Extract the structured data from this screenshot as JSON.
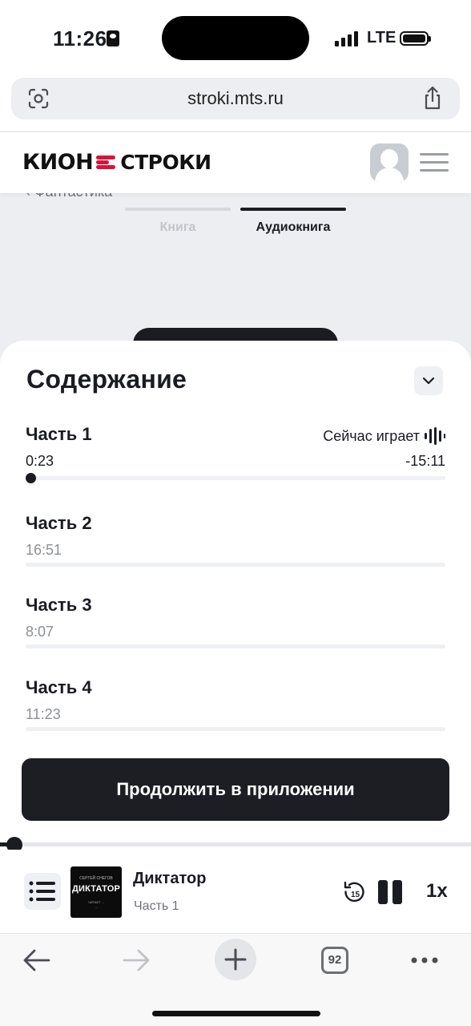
{
  "status_bar": {
    "time": "11:26",
    "network": "LTE"
  },
  "browser": {
    "url": "stroki.mts.ru",
    "open_tabs": "92"
  },
  "site": {
    "logo_left": "КИОН",
    "logo_right": "СТРОКИ",
    "breadcrumb": "‹  Фантастика",
    "tabs": [
      {
        "label": "Книга",
        "active": false
      },
      {
        "label": "Аудиокнига",
        "active": true
      }
    ]
  },
  "contents_sheet": {
    "title": "Содержание",
    "now_playing_label": "Сейчас играет",
    "chapters": [
      {
        "name": "Часть 1",
        "duration": "0:23",
        "remaining": "-15:11",
        "progress": 0.0,
        "playing": true
      },
      {
        "name": "Часть 2",
        "duration": "16:51"
      },
      {
        "name": "Часть 3",
        "duration": "8:07"
      },
      {
        "name": "Часть 4",
        "duration": "11:23"
      }
    ],
    "continue_button": "Продолжить в приложении"
  },
  "player": {
    "title": "Диктатор",
    "subtitle": "Часть 1",
    "speed": "1x",
    "rewind_seconds": "15",
    "progress": 0.03,
    "cover": {
      "author": "СЕРГЕЙ СНЕГОВ",
      "title": "ДИКТАТОР",
      "credit": "ЧИТАЕТ ...",
      "credit2": "..."
    }
  },
  "colors": {
    "accent": "#d8143a",
    "dark": "#1d1e23",
    "backdrop": "#edeef1"
  }
}
